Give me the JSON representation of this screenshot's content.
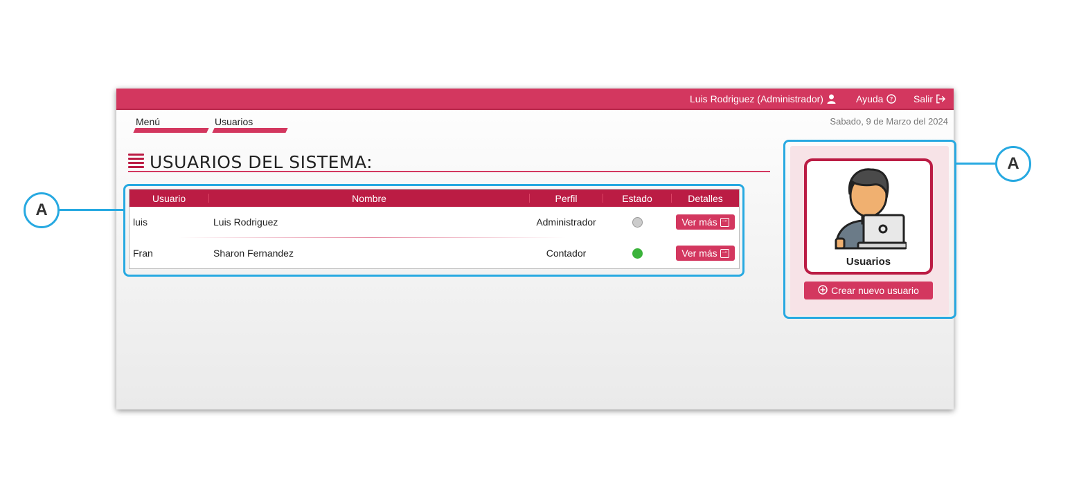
{
  "topbar": {
    "user_label": "Luis Rodriguez (Administrador)",
    "help_label": "Ayuda",
    "logout_label": "Salir"
  },
  "breadcrumb": {
    "items": [
      {
        "label": "Menú"
      },
      {
        "label": "Usuarios"
      }
    ]
  },
  "date": "Sabado, 9 de Marzo del 2024",
  "page_title": "USUARIOS DEL SISTEMA:",
  "table": {
    "headers": {
      "usuario": "Usuario",
      "nombre": "Nombre",
      "perfil": "Perfil",
      "estado": "Estado",
      "detalles": "Detalles"
    },
    "rows": [
      {
        "usuario": "luis",
        "nombre": "Luis Rodriguez",
        "perfil": "Administrador",
        "estado": "inactive",
        "estado_color": "#cccccc",
        "action": "Ver más"
      },
      {
        "usuario": "Fran",
        "nombre": "Sharon Fernandez",
        "perfil": "Contador",
        "estado": "active",
        "estado_color": "#3bb33b",
        "action": "Ver más"
      }
    ]
  },
  "side_panel": {
    "card_label": "Usuarios",
    "create_button": "Crear nuevo usuario"
  },
  "annotations": {
    "left_label": "A",
    "right_label": "A"
  },
  "colors": {
    "accent": "#d3375f",
    "header": "#bb1c44",
    "annotation": "#27a9e1"
  }
}
